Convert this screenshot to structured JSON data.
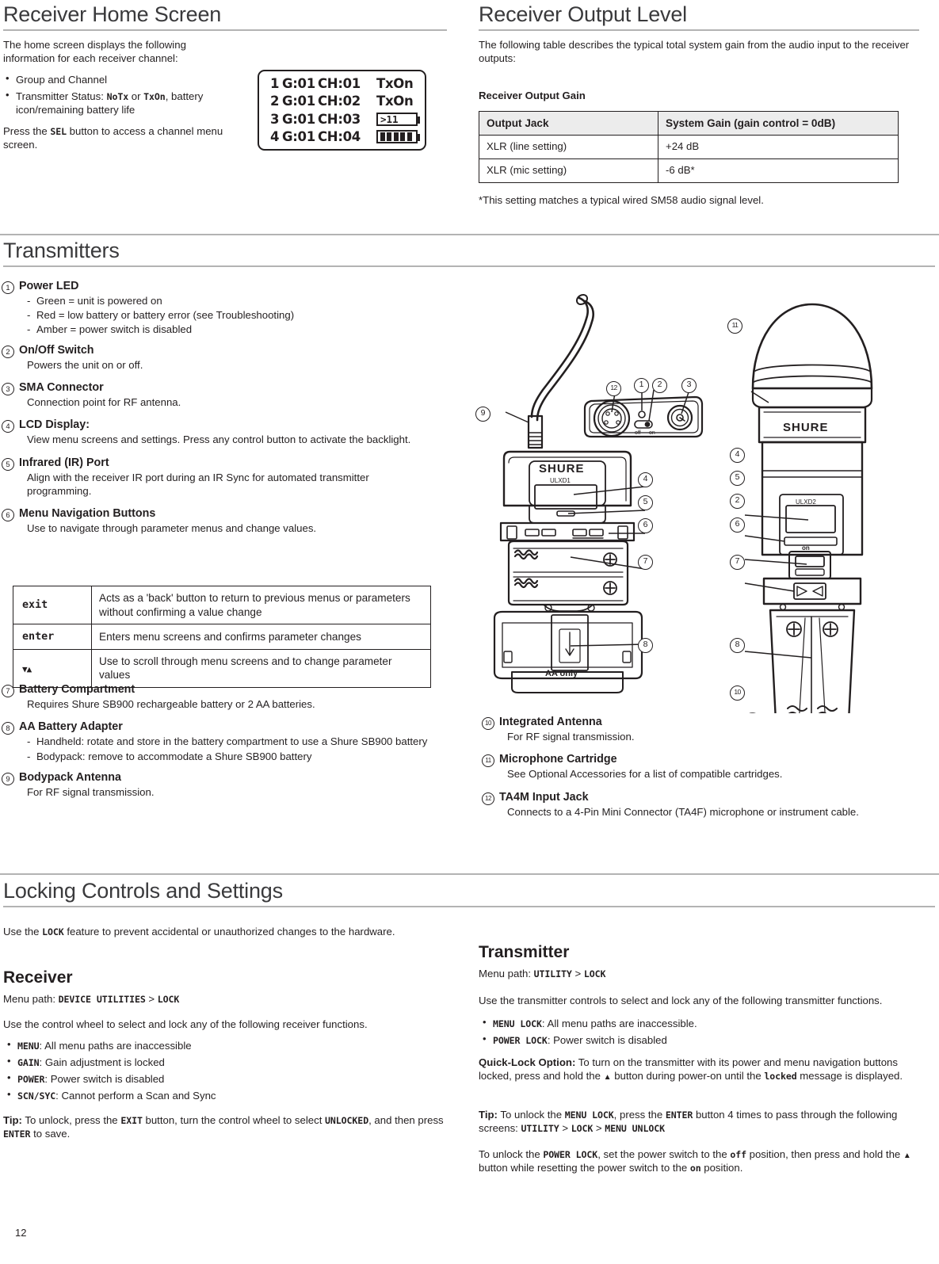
{
  "page": {
    "number": "12"
  },
  "sections": {
    "receiver_home": {
      "title": "Receiver Home Screen",
      "intro": "The home screen displays the following information for each receiver channel:",
      "bullets": [
        {
          "prefix": "Group and Channel"
        },
        {
          "prefix": "Transmitter Status: ",
          "code1": "NoTx",
          "mid": " or ",
          "code2": "TxOn",
          "suffix": ", battery icon/remaining battery life"
        }
      ],
      "outro_pre": "Press the ",
      "outro_code": "SEL",
      "outro_post": " button to access a channel menu screen.",
      "lcd": {
        "rows": [
          {
            "ch": "1",
            "group": "G:01",
            "chan": "CH:01",
            "status_type": "text",
            "status": "TxOn"
          },
          {
            "ch": "2",
            "group": "G:01",
            "chan": "CH:02",
            "status_type": "text",
            "status": "TxOn"
          },
          {
            "ch": "3",
            "group": "G:01",
            "chan": "CH:03",
            "status_type": "battery-hours",
            "status": ">11"
          },
          {
            "ch": "4",
            "group": "G:01",
            "chan": "CH:04",
            "status_type": "battery-bars",
            "status": "5"
          }
        ]
      }
    },
    "receiver_output": {
      "title": "Receiver Output Level",
      "intro": "The following table describes the typical total system gain from the audio input to the receiver outputs:",
      "table_caption": "Receiver Output Gain",
      "table": {
        "headers": [
          "Output Jack",
          "System Gain (gain control = 0dB)"
        ],
        "rows": [
          [
            "XLR (line setting)",
            "+24 dB"
          ],
          [
            "XLR (mic setting)",
            "-6 dB*"
          ]
        ]
      },
      "footnote": "*This setting matches a typical wired SM58 audio signal level."
    },
    "transmitters": {
      "title": "Transmitters",
      "items_left": [
        {
          "num": "1",
          "title": "Power LED",
          "dashes": [
            "Green = unit is powered on",
            "Red = low battery or battery error (see Troubleshooting)",
            "Amber = power switch is disabled"
          ]
        },
        {
          "num": "2",
          "title": "On/Off Switch",
          "desc": "Powers the unit on or off."
        },
        {
          "num": "3",
          "title": "SMA Connector",
          "desc": "Connection point for RF antenna."
        },
        {
          "num": "4",
          "title": "LCD Display:",
          "desc": "View menu screens and settings. Press any control button to activate the backlight."
        },
        {
          "num": "5",
          "title": "Infrared (IR) Port",
          "desc": "Align with the receiver IR port during an IR Sync for automated transmitter programming."
        },
        {
          "num": "6",
          "title": "Menu Navigation Buttons",
          "desc": "Use to navigate through parameter menus and change values."
        }
      ],
      "nav_table": [
        {
          "key": "exit",
          "desc": "Acts as a 'back' button to return to previous menus or parameters without confirming a value change"
        },
        {
          "key": "enter",
          "desc": "Enters menu screens and confirms parameter changes"
        },
        {
          "key": "▼▲",
          "desc": "Use to scroll through menu screens and to change parameter values"
        }
      ],
      "items_left_2": [
        {
          "num": "7",
          "title": "Battery Compartment",
          "desc": "Requires Shure SB900 rechargeable battery or 2 AA batteries."
        },
        {
          "num": "8",
          "title": "AA Battery Adapter",
          "dashes": [
            "Handheld: rotate and store in the battery compartment to use a Shure SB900 battery",
            "Bodypack: remove to accommodate a Shure SB900 battery"
          ]
        },
        {
          "num": "9",
          "title": "Bodypack Antenna",
          "desc": "For RF signal transmission."
        }
      ],
      "items_right": [
        {
          "num": "10",
          "title": "Integrated Antenna",
          "desc": "For RF signal transmission."
        },
        {
          "num": "11",
          "title": "Microphone Cartridge",
          "desc": "See Optional Accessories for a list of compatible cartridges."
        },
        {
          "num": "12",
          "title": "TA4M Input Jack",
          "desc": "Connects to a 4-Pin Mini Connector (TA4F) microphone or instrument cable."
        }
      ],
      "diagram_labels": {
        "brand": "SHURE",
        "bodypack_model": "ULXD1",
        "handheld_model": "ULXD2",
        "switch_off": "off",
        "switch_on": "on",
        "aa_only": "AA only",
        "handheld_on": "on"
      },
      "callouts_bodypack": [
        "12",
        "1",
        "2",
        "3",
        "9",
        "4",
        "5",
        "6",
        "7",
        "8"
      ],
      "callouts_handheld": [
        "11",
        "4",
        "5",
        "2",
        "6",
        "7",
        "8",
        "10"
      ]
    },
    "locking": {
      "title": "Locking Controls and Settings",
      "intro_pre": "Use the ",
      "intro_code": "LOCK",
      "intro_post": " feature to prevent accidental or unauthorized changes to the hardware.",
      "receiver": {
        "heading": "Receiver",
        "menu_path_label": "Menu path: ",
        "menu_path_code1": "DEVICE UTILITIES",
        "menu_path_sep": " > ",
        "menu_path_code2": "LOCK",
        "lead": "Use the control wheel to select and lock any of the following receiver functions.",
        "bullets": [
          {
            "code": "MENU",
            "text": ": All menu paths are inaccessible"
          },
          {
            "code": "GAIN",
            "text": ": Gain adjustment is locked"
          },
          {
            "code": "POWER",
            "text": ": Power switch is disabled"
          },
          {
            "code": "SCN/SYC",
            "text": ": Cannot perform a Scan and Sync"
          }
        ],
        "tip_label": "Tip:",
        "tip_p1": " To unlock, press the ",
        "tip_c1": "EXIT",
        "tip_p2": " button, turn the control wheel to select ",
        "tip_c2": "UNLOCKED",
        "tip_p3": ", and then press ",
        "tip_c3": "ENTER",
        "tip_p4": " to save."
      },
      "transmitter": {
        "heading": "Transmitter",
        "menu_path_label": "Menu path: ",
        "menu_path_code1": "UTILITY",
        "menu_path_sep": " > ",
        "menu_path_code2": "LOCK",
        "lead": "Use the transmitter controls to select and lock any of the following transmitter functions.",
        "bullets": [
          {
            "code": "MENU LOCK",
            "text": ": All menu paths are inaccessible."
          },
          {
            "code": "POWER LOCK",
            "text": ": Power switch is disabled"
          }
        ],
        "quick_label": "Quick-Lock Option:",
        "quick_p1": " To turn on the transmitter with its power and menu navigation buttons locked, press and hold the ",
        "quick_arrow": "▲",
        "quick_p2": " button during power-on until the ",
        "quick_c1": "locked",
        "quick_p3": " message is displayed.",
        "tip_label": "Tip:",
        "tip_p1": " To unlock the ",
        "tip_c1": "MENU LOCK",
        "tip_p2": ", press the ",
        "tip_c2": "ENTER",
        "tip_p3": " button 4 times to pass through the following screens: ",
        "tip_c3": "UTILITY",
        "tip_sep1": " > ",
        "tip_c4": "LOCK",
        "tip_sep2": " > ",
        "tip_c5": "MENU UNLOCK",
        "final_p1": "To unlock the ",
        "final_c1": "POWER LOCK",
        "final_p2": ", set the power switch to the ",
        "final_c2": "off",
        "final_p3": " position, then press and hold the ",
        "final_arrow": "▲",
        "final_p4": " button while resetting the power switch to the ",
        "final_c3": "on",
        "final_p5": " position."
      }
    }
  }
}
